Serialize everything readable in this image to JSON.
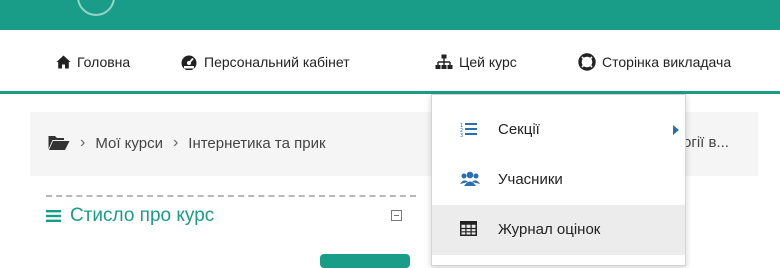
{
  "nav": {
    "home": "Головна",
    "dashboard": "Персональний кабінет",
    "this_course": "Цей курс",
    "teacher_page": "Сторінка викладача"
  },
  "breadcrumb": {
    "my_courses": "Мої курси",
    "course": "Інтернетика та прик",
    "course_tail": "огії в..."
  },
  "block": {
    "title": "Стисло про курс"
  },
  "dropdown": {
    "items": [
      {
        "label": "Секції",
        "icon": "list-ol-icon",
        "has_submenu": true
      },
      {
        "label": "Учасники",
        "icon": "users-icon"
      },
      {
        "label": "Журнал оцінок",
        "icon": "table-icon",
        "highlighted": true
      }
    ]
  },
  "colors": {
    "accent": "#199d88",
    "breadcrumb_bg": "#f5f5f5"
  }
}
